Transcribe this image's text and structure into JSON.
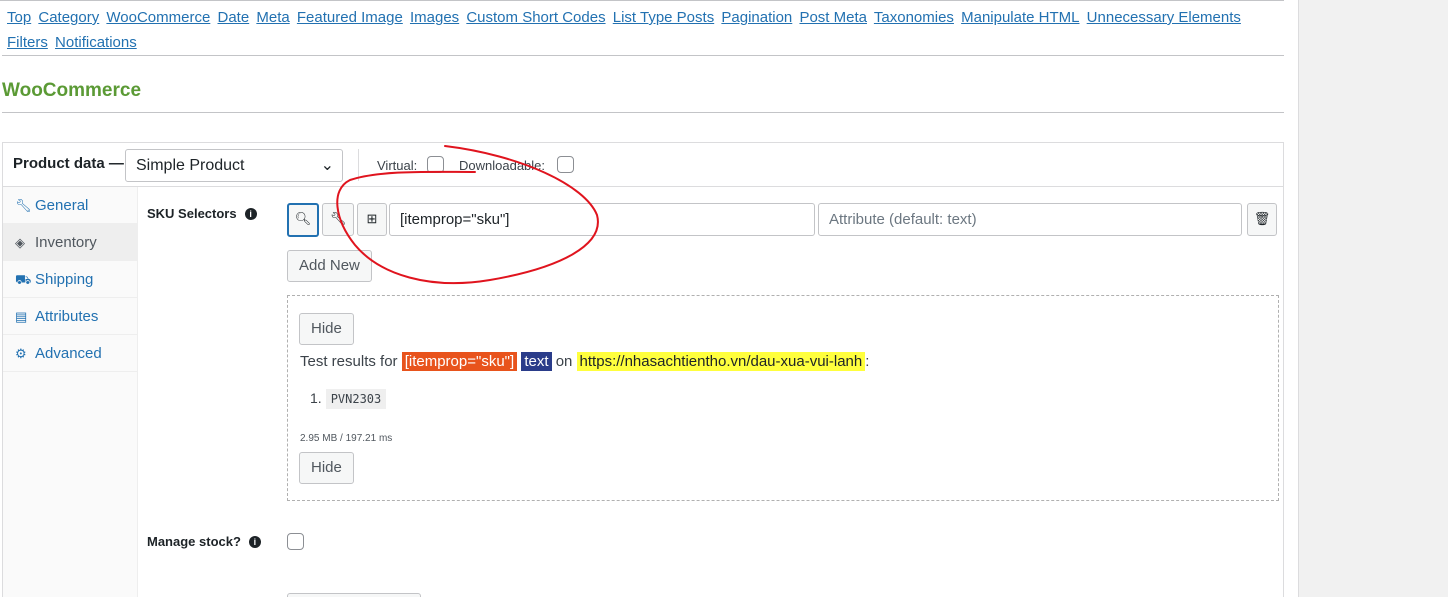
{
  "nav": {
    "links": [
      "Top",
      "Category",
      "WooCommerce",
      "Date",
      "Meta",
      "Featured Image",
      "Images",
      "Custom Short Codes",
      "List Type Posts",
      "Pagination",
      "Post Meta",
      "Taxonomies",
      "Manipulate HTML",
      "Unnecessary Elements",
      "Filters",
      "Notifications"
    ]
  },
  "section": {
    "title": "WooCommerce"
  },
  "product_data": {
    "label": "Product data —",
    "type_select": "Simple Product",
    "virtual_label": "Virtual:",
    "downloadable_label": "Downloadable:"
  },
  "tabs": [
    {
      "label": "General",
      "icon": "wrench-icon"
    },
    {
      "label": "Inventory",
      "icon": "tag-icon"
    },
    {
      "label": "Shipping",
      "icon": "truck-icon"
    },
    {
      "label": "Attributes",
      "icon": "list-icon"
    },
    {
      "label": "Advanced",
      "icon": "gear-icon"
    }
  ],
  "sku": {
    "label": "SKU Selectors",
    "selector_value": "[itemprop=\"sku\"]",
    "attribute_placeholder": "Attribute (default: text)",
    "add_new": "Add New"
  },
  "test": {
    "hide_top": "Hide",
    "prefix": "Test results for",
    "selector": "[itemprop=\"sku\"]",
    "attr": "text",
    "on": "on",
    "url": "https://nhasachtientho.vn/dau-xua-vui-lanh",
    "colon": ":",
    "result_number": "1.",
    "result_value": "PVN2303",
    "stats": "2.95 MB / 197.21 ms",
    "hide_bottom": "Hide"
  },
  "manage_stock": {
    "label": "Manage stock?"
  },
  "colors": {
    "link": "#2271b1",
    "section_title": "#5b9a35",
    "annotation": "#e0141e",
    "selector_bg": "#e8531c",
    "attr_bg": "#2a3c8a",
    "url_bg": "#ffff3d"
  }
}
